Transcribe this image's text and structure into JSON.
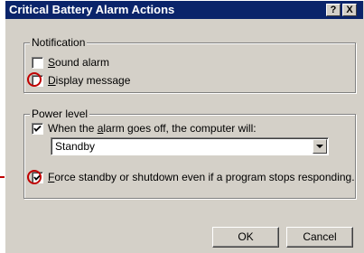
{
  "dialog": {
    "title": "Critical Battery Alarm Actions",
    "help_button": "?",
    "close_button": "X"
  },
  "notification": {
    "legend": "Notification",
    "sound_alarm": {
      "prefix": "",
      "accel": "S",
      "rest": "ound alarm",
      "checked": false
    },
    "display_message": {
      "prefix": "",
      "accel": "D",
      "rest": "isplay message",
      "checked": false
    }
  },
  "power_level": {
    "legend": "Power level",
    "when_alarm": {
      "prefix": "When the ",
      "accel": "a",
      "rest": "larm goes off, the computer will:",
      "checked": true
    },
    "action_select": {
      "value": "Standby"
    },
    "force": {
      "prefix": "",
      "accel": "F",
      "rest": "orce standby or shutdown even if a program stops responding.",
      "checked": true
    }
  },
  "buttons": {
    "ok": "OK",
    "cancel": "Cancel"
  }
}
